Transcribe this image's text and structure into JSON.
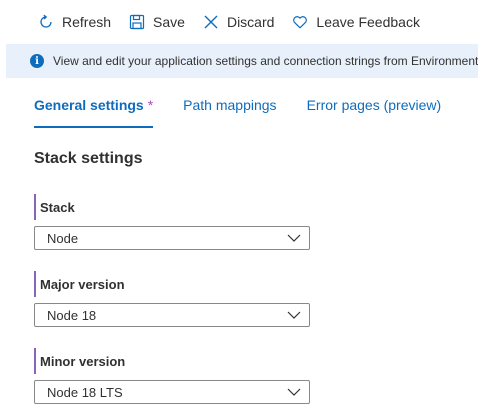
{
  "toolbar": {
    "refresh_label": "Refresh",
    "save_label": "Save",
    "discard_label": "Discard",
    "feedback_label": "Leave Feedback"
  },
  "banner": {
    "message": "View and edit your application settings and connection strings from Environment"
  },
  "tabs": [
    {
      "label": "General settings",
      "modified_marker": "*",
      "active": true
    },
    {
      "label": "Path mappings",
      "active": false
    },
    {
      "label": "Error pages (preview)",
      "active": false
    }
  ],
  "section": {
    "title": "Stack settings"
  },
  "fields": {
    "stack": {
      "label": "Stack",
      "value": "Node"
    },
    "major_version": {
      "label": "Major version",
      "value": "Node 18"
    },
    "minor_version": {
      "label": "Minor version",
      "value": "Node 18 LTS"
    }
  },
  "colors": {
    "accent": "#0f6cbd",
    "banner_bg": "#e8f1fb",
    "required_bar": "#8764b8",
    "modified_marker": "#b146c2"
  },
  "icons": {
    "refresh": "refresh-icon",
    "save": "save-icon",
    "discard": "close-icon",
    "feedback": "heart-icon",
    "info": "info-icon",
    "chevron": "chevron-down-icon"
  }
}
